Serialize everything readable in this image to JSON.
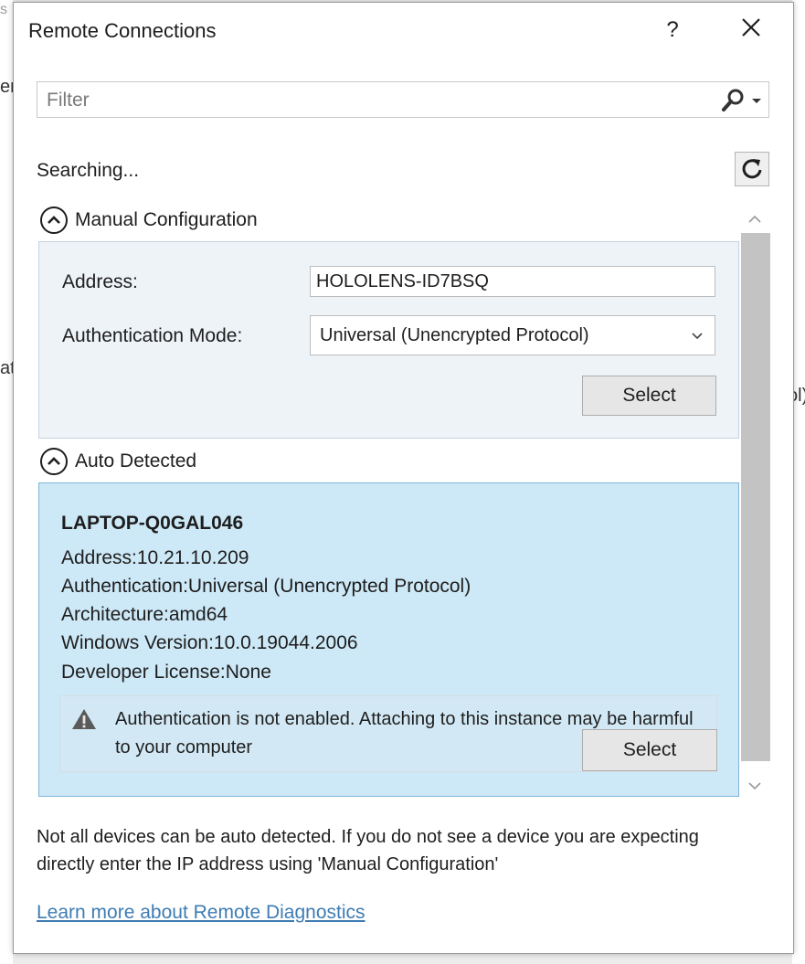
{
  "background": {
    "fragments": [
      "s",
      "er",
      "at",
      "ol)"
    ]
  },
  "dialog": {
    "title": "Remote Connections",
    "help_label": "?",
    "filter": {
      "placeholder": "Filter"
    },
    "status": "Searching...",
    "manual": {
      "header": "Manual Configuration",
      "address_label": "Address:",
      "address_value": "HOLOLENS-ID7BSQ",
      "auth_label": "Authentication Mode:",
      "auth_value": "Universal (Unencrypted Protocol)",
      "select_label": "Select"
    },
    "auto": {
      "header": "Auto Detected",
      "device": {
        "name": "LAPTOP-Q0GAL046",
        "address": "Address:10.21.10.209",
        "authentication": "Authentication:Universal (Unencrypted Protocol)",
        "architecture": "Architecture:amd64",
        "windows_version": "Windows Version:10.0.19044.2006",
        "developer_license": "Developer License:None",
        "warning": "Authentication is not enabled. Attaching to this instance may be harmful to your computer",
        "select_label": "Select"
      }
    },
    "footer_note": "Not all devices can be auto detected. If you do not see a device you are expecting directly enter the IP address using 'Manual Configuration'",
    "learn_more": "Learn more about Remote Diagnostics"
  },
  "icons": {
    "close": "close-icon",
    "search": "search-icon",
    "refresh": "refresh-icon",
    "collapse": "chevron-up-icon",
    "dropdown": "chevron-down-icon",
    "warning": "warning-icon"
  },
  "colors": {
    "device_card_bg": "#cde8f6",
    "manual_panel_bg": "#eef3f8",
    "link": "#3e7cb3",
    "scroll_track": "#c3c3c3"
  }
}
